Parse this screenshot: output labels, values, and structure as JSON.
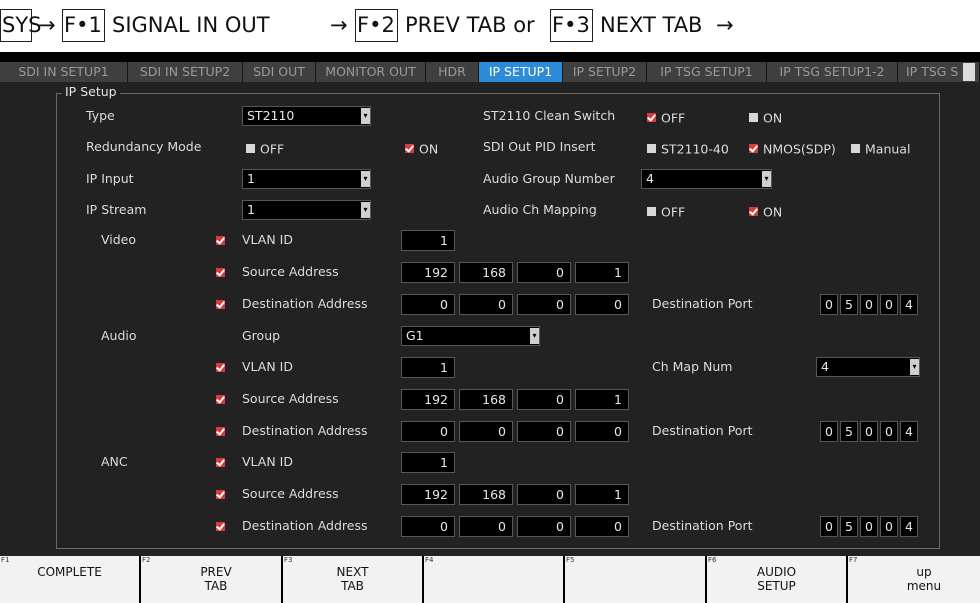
{
  "instruction": {
    "sys": "SYS",
    "arrow": "→",
    "f1_key": "F•1",
    "f1_text": "SIGNAL IN OUT",
    "f2_key": "F•2",
    "f2_text": "PREV TAB or",
    "f3_key": "F•3",
    "f3_text": "NEXT TAB"
  },
  "tabs": [
    {
      "label": "SDI IN SETUP1",
      "active": false
    },
    {
      "label": "SDI IN SETUP2",
      "active": false
    },
    {
      "label": "SDI OUT",
      "active": false
    },
    {
      "label": "MONITOR OUT",
      "active": false
    },
    {
      "label": "HDR",
      "active": false
    },
    {
      "label": "IP SETUP1",
      "active": true
    },
    {
      "label": "IP SETUP2",
      "active": false
    },
    {
      "label": "IP TSG SETUP1",
      "active": false
    },
    {
      "label": "IP TSG SETUP1-2",
      "active": false
    },
    {
      "label": "IP TSG S",
      "active": false
    }
  ],
  "ip_setup": {
    "title": "IP Setup",
    "type": {
      "label": "Type",
      "value": "ST2110"
    },
    "redundancy": {
      "label": "Redundancy Mode",
      "off": "OFF",
      "on": "ON",
      "selected": "ON"
    },
    "ip_input": {
      "label": "IP Input",
      "value": "1"
    },
    "ip_stream": {
      "label": "IP Stream",
      "value": "1"
    },
    "clean_switch": {
      "label": "ST2110 Clean Switch",
      "off": "OFF",
      "on": "ON",
      "selected": "OFF"
    },
    "pid_insert": {
      "label": "SDI Out PID Insert",
      "opt1": "ST2110-40",
      "opt2": "NMOS(SDP)",
      "opt3": "Manual",
      "selected": "NMOS(SDP)"
    },
    "audio_group_number": {
      "label": "Audio Group Number",
      "value": "4"
    },
    "audio_ch_mapping": {
      "label": "Audio Ch Mapping",
      "off": "OFF",
      "on": "ON",
      "selected": "ON"
    },
    "video": {
      "label": "Video",
      "vlan_label": "VLAN ID",
      "vlan": "1",
      "src_label": "Source Address",
      "src": [
        "192",
        "168",
        "0",
        "1"
      ],
      "dst_label": "Destination Address",
      "dst": [
        "0",
        "0",
        "0",
        "0"
      ],
      "port_label": "Destination Port",
      "port": [
        "0",
        "5",
        "0",
        "0",
        "4"
      ]
    },
    "audio": {
      "label": "Audio",
      "group_label": "Group",
      "group": "G1",
      "vlan_label": "VLAN ID",
      "vlan": "1",
      "ch_map_label": "Ch Map Num",
      "ch_map": "4",
      "src_label": "Source Address",
      "src": [
        "192",
        "168",
        "0",
        "1"
      ],
      "dst_label": "Destination Address",
      "dst": [
        "0",
        "0",
        "0",
        "0"
      ],
      "port_label": "Destination Port",
      "port": [
        "0",
        "5",
        "0",
        "0",
        "4"
      ]
    },
    "anc": {
      "label": "ANC",
      "vlan_label": "VLAN ID",
      "vlan": "1",
      "src_label": "Source Address",
      "src": [
        "192",
        "168",
        "0",
        "1"
      ],
      "dst_label": "Destination Address",
      "dst": [
        "0",
        "0",
        "0",
        "0"
      ],
      "port_label": "Destination Port",
      "port": [
        "0",
        "5",
        "0",
        "0",
        "4"
      ]
    }
  },
  "function_keys": {
    "f1": {
      "num": "F1",
      "line1": "COMPLETE",
      "line2": ""
    },
    "f2": {
      "num": "F2",
      "line1": "PREV",
      "line2": "TAB"
    },
    "f3": {
      "num": "F3",
      "line1": "NEXT",
      "line2": "TAB"
    },
    "f4": {
      "num": "F4",
      "line1": "",
      "line2": ""
    },
    "f5": {
      "num": "F5",
      "line1": "",
      "line2": ""
    },
    "f6": {
      "num": "F6",
      "line1": "AUDIO",
      "line2": "SETUP"
    },
    "f7": {
      "num": "F7",
      "line1": "up",
      "line2": "menu"
    }
  },
  "colors": {
    "tab_active": "#2e8bd7",
    "checkbox_on": "#d93a3a",
    "checkbox_off": "#d7d7d7",
    "panel_bg": "#222222"
  }
}
